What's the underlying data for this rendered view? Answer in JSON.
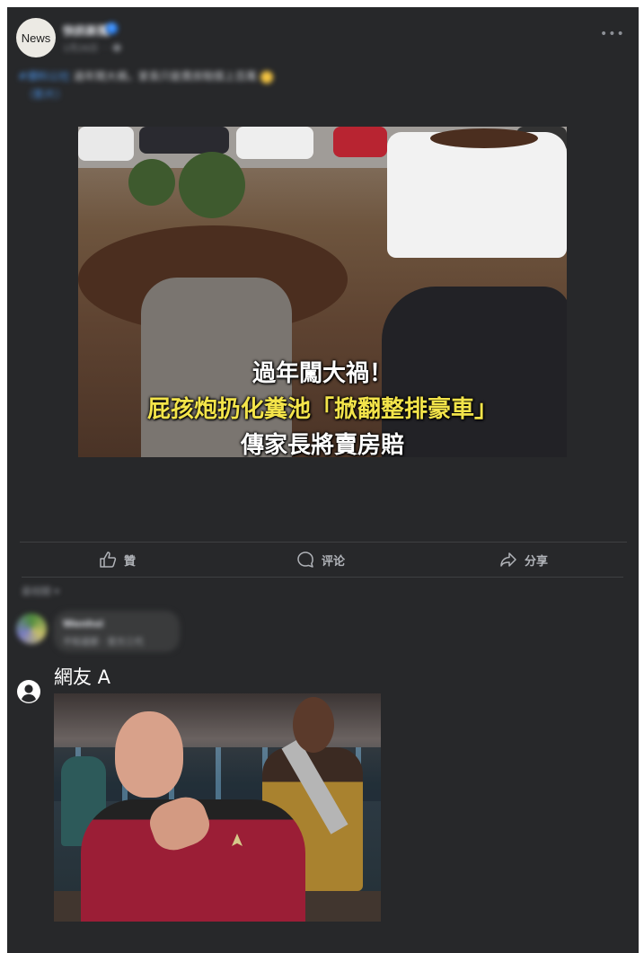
{
  "post": {
    "avatar_label": "News",
    "page_name": "快訊新聞",
    "meta": "1月26日 · · ☻",
    "text_link": "#爆料公社",
    "text_body": " 過年鬧大禍，家長只能賣房賠償上百萬 ",
    "text_line2": "（影片）",
    "image_caption_line1": "過年闖大禍！",
    "image_caption_line2": "屁孩炮扔化糞池「掀翻整排豪車」",
    "image_caption_line3": "傳家長將賣房賠"
  },
  "actions": {
    "like_label": "贊",
    "comment_label": "评论",
    "share_label": "分享"
  },
  "comments": {
    "sort_label": "最相關 ▾",
    "first": {
      "name": "Wenhsi",
      "text": "不知道那 · 官方三代"
    },
    "second": {
      "name": "網友 A"
    }
  },
  "colors": {
    "panel_bg": "#27282a",
    "caption_yellow": "#f3e44a",
    "link_blue": "#4a90e2"
  },
  "icons": [
    "more-icon",
    "like-icon",
    "comment-icon",
    "share-icon",
    "user-icon",
    "verified-icon"
  ]
}
